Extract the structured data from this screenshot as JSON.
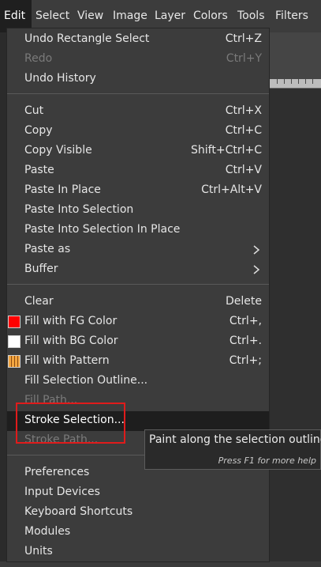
{
  "menubar": {
    "items": [
      {
        "label": "Edit",
        "active": true
      },
      {
        "label": "Select"
      },
      {
        "label": "View"
      },
      {
        "label": "Image"
      },
      {
        "label": "Layer"
      },
      {
        "label": "Colors"
      },
      {
        "label": "Tools"
      },
      {
        "label": "Filters"
      }
    ]
  },
  "menu": {
    "items": [
      {
        "label": "Undo Rectangle Select",
        "accel": "Ctrl+Z"
      },
      {
        "label": "Redo",
        "accel": "Ctrl+Y",
        "disabled": true
      },
      {
        "label": "Undo History",
        "accel": ""
      },
      {
        "label": "Cut",
        "accel": "Ctrl+X"
      },
      {
        "label": "Copy",
        "accel": "Ctrl+C"
      },
      {
        "label": "Copy Visible",
        "accel": "Shift+Ctrl+C"
      },
      {
        "label": "Paste",
        "accel": "Ctrl+V"
      },
      {
        "label": "Paste In Place",
        "accel": "Ctrl+Alt+V"
      },
      {
        "label": "Paste Into Selection",
        "accel": ""
      },
      {
        "label": "Paste Into Selection In Place",
        "accel": ""
      },
      {
        "label": "Paste as",
        "accel": "",
        "submenu": true
      },
      {
        "label": "Buffer",
        "accel": "",
        "submenu": true
      },
      {
        "label": "Clear",
        "accel": "Delete"
      },
      {
        "label": "Fill with FG Color",
        "accel": "Ctrl+,",
        "icon": "fg-color-swatch-icon"
      },
      {
        "label": "Fill with BG Color",
        "accel": "Ctrl+.",
        "icon": "bg-color-swatch-icon"
      },
      {
        "label": "Fill with Pattern",
        "accel": "Ctrl+;",
        "icon": "pattern-swatch-icon"
      },
      {
        "label": "Fill Selection Outline...",
        "accel": ""
      },
      {
        "label": "Fill Path...",
        "accel": "",
        "disabled": true
      },
      {
        "label": "Stroke Selection...",
        "accel": "",
        "hover": true
      },
      {
        "label": "Stroke Path...",
        "accel": "",
        "disabled": true
      },
      {
        "label": "Preferences",
        "accel": ""
      },
      {
        "label": "Input Devices",
        "accel": ""
      },
      {
        "label": "Keyboard Shortcuts",
        "accel": ""
      },
      {
        "label": "Modules",
        "accel": ""
      },
      {
        "label": "Units",
        "accel": ""
      }
    ]
  },
  "tooltip": {
    "text": "Paint along the selection outline",
    "help": "Press F1 for more help"
  },
  "colors": {
    "highlight": "#e01b1b",
    "fg_swatch": "#ff0000",
    "bg_swatch": "#ffffff"
  }
}
